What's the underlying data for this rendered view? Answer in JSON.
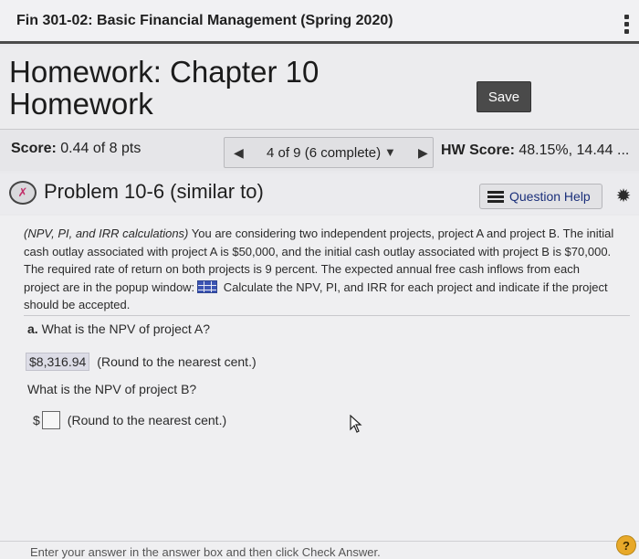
{
  "course": {
    "title": "Fin 301-02: Basic Financial Management (Spring 2020)"
  },
  "header": {
    "title": "Homework: Chapter 10 Homework",
    "save_label": "Save"
  },
  "score_bar": {
    "score_label": "Score:",
    "score_value": "0.44 of 8 pts",
    "progress": "4 of 9 (6 complete)",
    "hw_score_label": "HW Score:",
    "hw_score_value": "48.15%, 14.44 ..."
  },
  "problem": {
    "title": "Problem 10-6 (similar to)",
    "question_help_label": "Question Help",
    "text_intro": "(NPV, PI, and IRR calculations)",
    "text_body_1": " You are considering two independent projects, project A and project B. The initial cash outlay associated with project A is $50,000, and the initial cash outlay associated with project B is $70,000. The required rate of return on both projects is 9 percent. The expected annual free cash inflows from each project are in the popup window:",
    "text_body_2": " Calculate the NPV, PI, and IRR for each project and indicate if the project should be accepted."
  },
  "part_a": {
    "prefix": "a.",
    "question": "What is the NPV of project A?",
    "currency": "$",
    "answer_value": "8,316.94",
    "answer_hint": "(Round to the nearest cent.)"
  },
  "part_b": {
    "question": "What is the NPV of project B?",
    "currency": "$",
    "answer_value": "",
    "answer_hint": "(Round to the nearest cent.)"
  },
  "footer": {
    "instruction": "Enter your answer in the answer box and then click Check Answer.",
    "help_symbol": "?"
  }
}
